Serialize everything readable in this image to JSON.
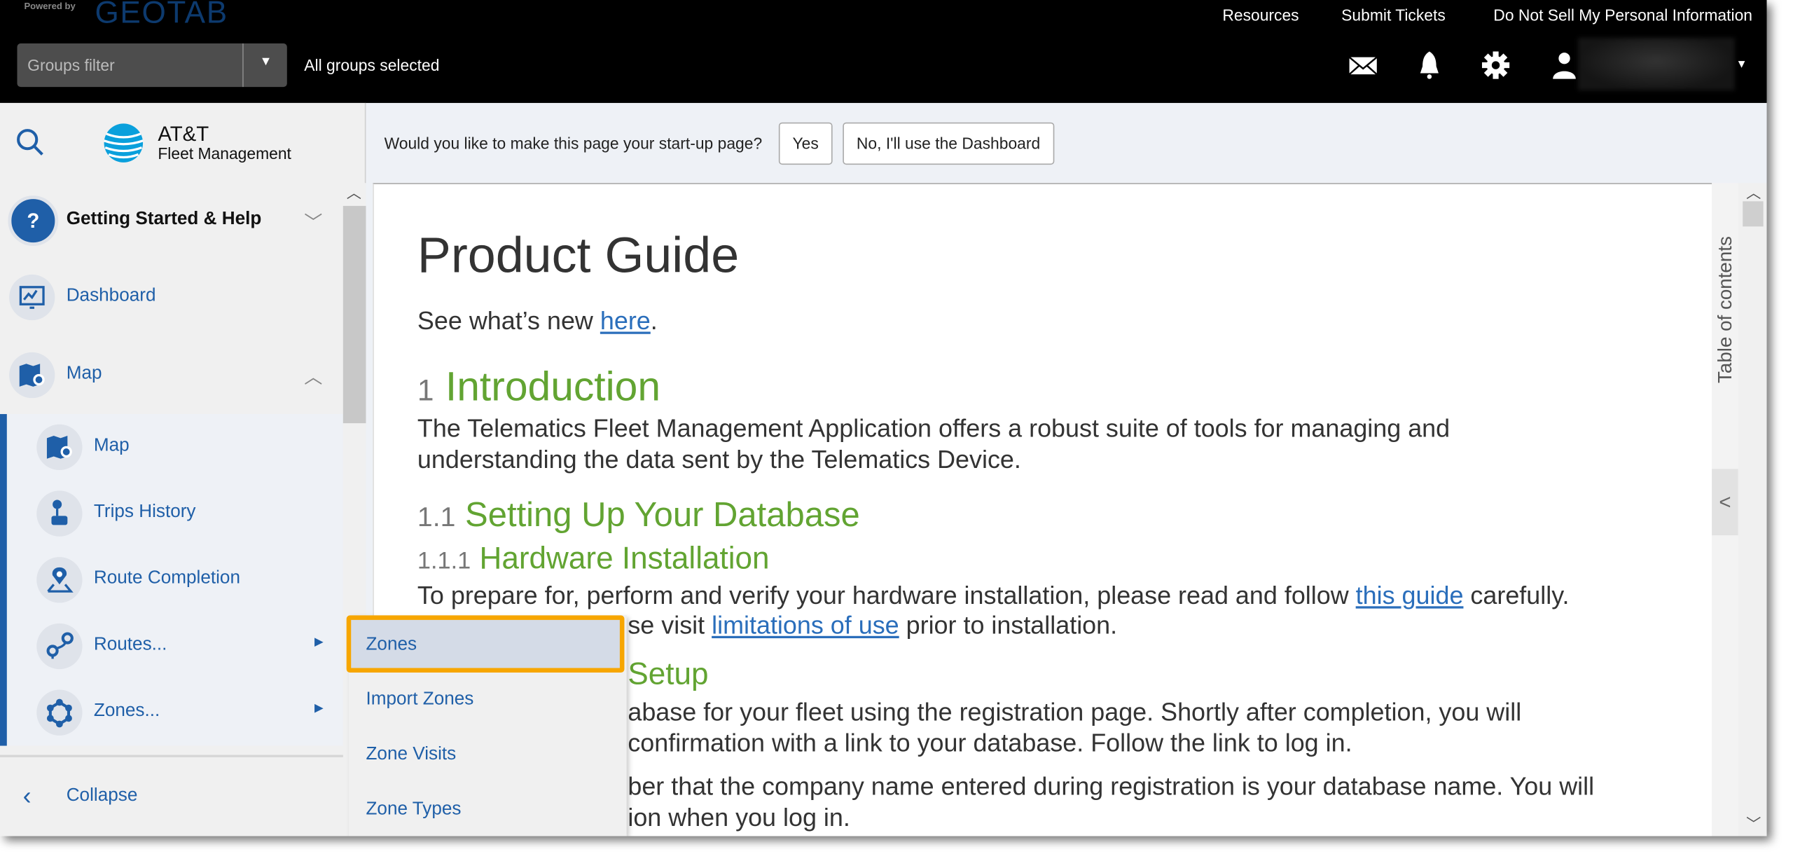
{
  "header": {
    "powered_by": "Powered by",
    "brand": "GEOTAB",
    "links": [
      "Resources",
      "Submit Tickets",
      "Do Not Sell My Personal Information"
    ],
    "groups_filter_placeholder": "Groups filter",
    "groups_status": "All groups selected",
    "icons": [
      "mail-icon",
      "bell-icon",
      "gear-icon",
      "user-icon"
    ]
  },
  "sidebar": {
    "logo_line1": "AT&T",
    "logo_line2": "Fleet Management",
    "items": [
      {
        "label": "Getting Started & Help"
      },
      {
        "label": "Dashboard"
      },
      {
        "label": "Map"
      }
    ],
    "map_subitems": [
      {
        "label": "Map"
      },
      {
        "label": "Trips History"
      },
      {
        "label": "Route Completion"
      },
      {
        "label": "Routes..."
      },
      {
        "label": "Zones..."
      }
    ],
    "collapse": "Collapse"
  },
  "startup": {
    "question": "Would you like to make this page your start-up page?",
    "yes": "Yes",
    "no": "No, I'll use the Dashboard"
  },
  "doc": {
    "title": "Product Guide",
    "whatsnew_pre": "See what’s new ",
    "whatsnew_link": "here",
    "whatsnew_post": ".",
    "h1_num": "1",
    "h1": "Introduction",
    "intro_l1": "The Telematics Fleet Management Application offers a robust suite of tools for managing and",
    "intro_l2": "understanding the data sent by the Telematics Device.",
    "h2_num": "1.1",
    "h2": "Setting Up Your Database",
    "h3_num": "1.1.1",
    "h3": "Hardware Installation",
    "hw_l1_pre": "To prepare for, perform and verify your hardware installation, please read and follow ",
    "hw_l1_link": "this guide",
    "hw_l1_post": " carefully.",
    "hw_l2_pre": "se visit ",
    "hw_l2_link": "limitations of use",
    "hw_l2_post": " prior to installation.",
    "setup_frag": "Setup",
    "p1_l1": "abase for your fleet using the registration page. Shortly after completion, you will",
    "p1_l2": "confirmation with a link to your database. Follow the link to log in.",
    "p2_l1": "ber that the company name entered during registration is your database name. You will",
    "p2_l2": "ion when you log in."
  },
  "toc": {
    "label": "Table of contents"
  },
  "flyout": {
    "items": [
      "Zones",
      "Import Zones",
      "Zone Visits",
      "Zone Types"
    ],
    "selected": "Zones"
  },
  "colors": {
    "accent_blue": "#1f5fa8",
    "heading_green": "#62a432",
    "highlight_orange": "#f7a600"
  }
}
